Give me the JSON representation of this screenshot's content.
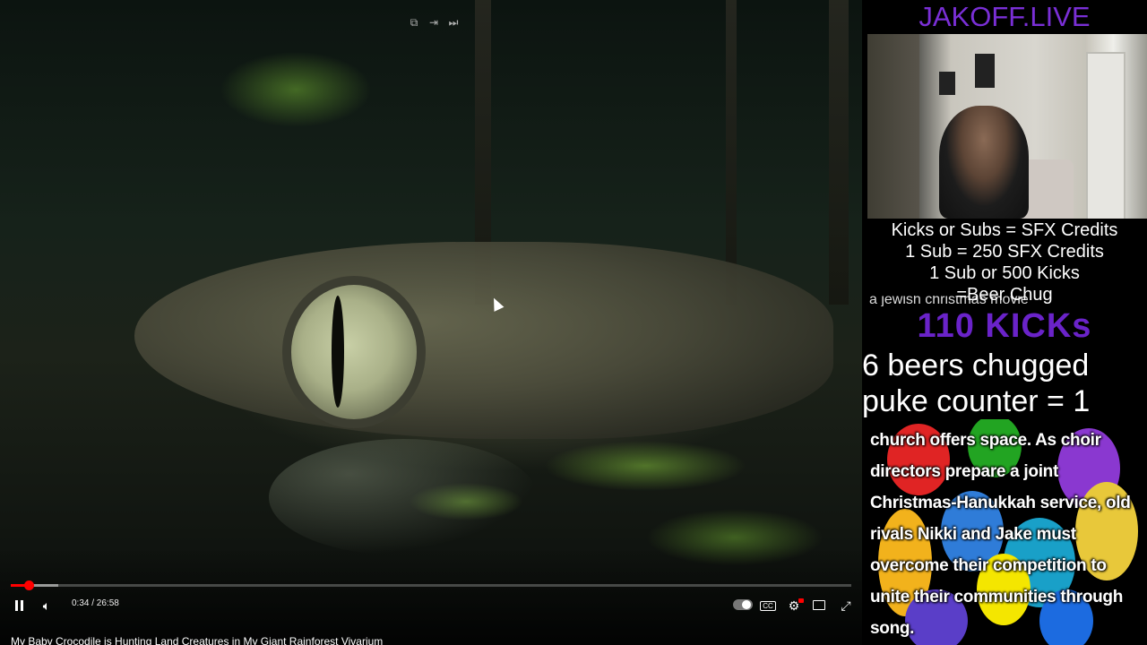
{
  "player": {
    "time_display": "0:34 / 26:58",
    "title": "My Baby Crocodile is Hunting Land Creatures in My Giant Rainforest Vivarium",
    "progress_played": 0.021,
    "progress_buffered": 0.057,
    "top_icons": [
      "miniplayer-icon",
      "share-icon",
      "skip-icon"
    ],
    "control_icons": [
      "pause-icon",
      "volume-icon",
      "autoplay-toggle",
      "subtitles-icon",
      "settings-icon",
      "theater-icon",
      "fullscreen-icon"
    ],
    "accent_color": "#ff0000"
  },
  "stream": {
    "brand": "JAKOFF.LIVE",
    "brand_color": "#7a2fd6",
    "credit_lines": [
      "Kicks or Subs = SFX Credits",
      "1 Sub = 250 SFX Credits",
      "1 Sub or 500 Kicks",
      "=Beer Chug"
    ],
    "clipped_line": "a jewish christmas movie",
    "kicks": "110 KICKs",
    "kicks_color": "#6a23c9",
    "beers": "6 beers chugged",
    "puke": "puke counter = 1",
    "caption": "church offers space. As choir directors prepare a joint Christmas-Hanukkah service, old rivals Nikki and Jake must overcome their competition to unite their communities through song."
  }
}
